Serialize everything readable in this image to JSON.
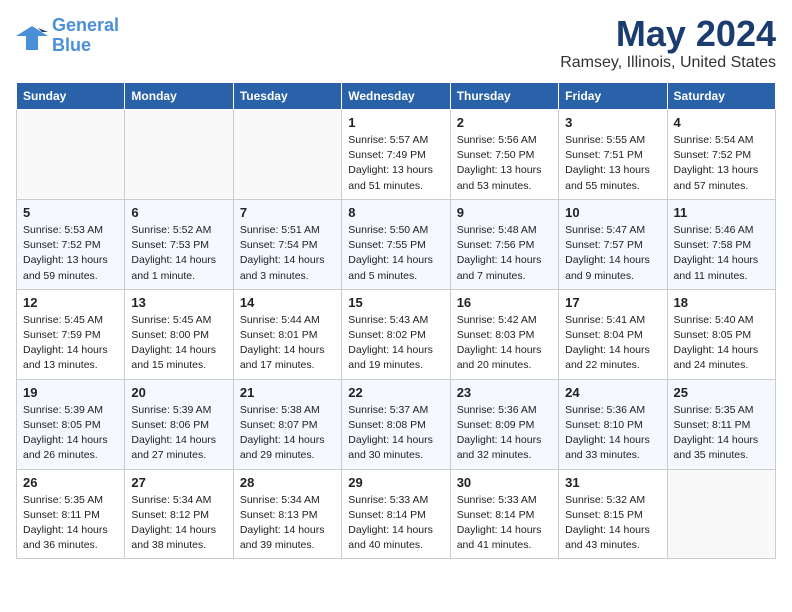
{
  "logo": {
    "line1": "General",
    "line2": "Blue"
  },
  "title": {
    "month": "May 2024",
    "location": "Ramsey, Illinois, United States"
  },
  "headers": [
    "Sunday",
    "Monday",
    "Tuesday",
    "Wednesday",
    "Thursday",
    "Friday",
    "Saturday"
  ],
  "weeks": [
    [
      {
        "day": "",
        "info": ""
      },
      {
        "day": "",
        "info": ""
      },
      {
        "day": "",
        "info": ""
      },
      {
        "day": "1",
        "info": "Sunrise: 5:57 AM\nSunset: 7:49 PM\nDaylight: 13 hours\nand 51 minutes."
      },
      {
        "day": "2",
        "info": "Sunrise: 5:56 AM\nSunset: 7:50 PM\nDaylight: 13 hours\nand 53 minutes."
      },
      {
        "day": "3",
        "info": "Sunrise: 5:55 AM\nSunset: 7:51 PM\nDaylight: 13 hours\nand 55 minutes."
      },
      {
        "day": "4",
        "info": "Sunrise: 5:54 AM\nSunset: 7:52 PM\nDaylight: 13 hours\nand 57 minutes."
      }
    ],
    [
      {
        "day": "5",
        "info": "Sunrise: 5:53 AM\nSunset: 7:52 PM\nDaylight: 13 hours\nand 59 minutes."
      },
      {
        "day": "6",
        "info": "Sunrise: 5:52 AM\nSunset: 7:53 PM\nDaylight: 14 hours\nand 1 minute."
      },
      {
        "day": "7",
        "info": "Sunrise: 5:51 AM\nSunset: 7:54 PM\nDaylight: 14 hours\nand 3 minutes."
      },
      {
        "day": "8",
        "info": "Sunrise: 5:50 AM\nSunset: 7:55 PM\nDaylight: 14 hours\nand 5 minutes."
      },
      {
        "day": "9",
        "info": "Sunrise: 5:48 AM\nSunset: 7:56 PM\nDaylight: 14 hours\nand 7 minutes."
      },
      {
        "day": "10",
        "info": "Sunrise: 5:47 AM\nSunset: 7:57 PM\nDaylight: 14 hours\nand 9 minutes."
      },
      {
        "day": "11",
        "info": "Sunrise: 5:46 AM\nSunset: 7:58 PM\nDaylight: 14 hours\nand 11 minutes."
      }
    ],
    [
      {
        "day": "12",
        "info": "Sunrise: 5:45 AM\nSunset: 7:59 PM\nDaylight: 14 hours\nand 13 minutes."
      },
      {
        "day": "13",
        "info": "Sunrise: 5:45 AM\nSunset: 8:00 PM\nDaylight: 14 hours\nand 15 minutes."
      },
      {
        "day": "14",
        "info": "Sunrise: 5:44 AM\nSunset: 8:01 PM\nDaylight: 14 hours\nand 17 minutes."
      },
      {
        "day": "15",
        "info": "Sunrise: 5:43 AM\nSunset: 8:02 PM\nDaylight: 14 hours\nand 19 minutes."
      },
      {
        "day": "16",
        "info": "Sunrise: 5:42 AM\nSunset: 8:03 PM\nDaylight: 14 hours\nand 20 minutes."
      },
      {
        "day": "17",
        "info": "Sunrise: 5:41 AM\nSunset: 8:04 PM\nDaylight: 14 hours\nand 22 minutes."
      },
      {
        "day": "18",
        "info": "Sunrise: 5:40 AM\nSunset: 8:05 PM\nDaylight: 14 hours\nand 24 minutes."
      }
    ],
    [
      {
        "day": "19",
        "info": "Sunrise: 5:39 AM\nSunset: 8:05 PM\nDaylight: 14 hours\nand 26 minutes."
      },
      {
        "day": "20",
        "info": "Sunrise: 5:39 AM\nSunset: 8:06 PM\nDaylight: 14 hours\nand 27 minutes."
      },
      {
        "day": "21",
        "info": "Sunrise: 5:38 AM\nSunset: 8:07 PM\nDaylight: 14 hours\nand 29 minutes."
      },
      {
        "day": "22",
        "info": "Sunrise: 5:37 AM\nSunset: 8:08 PM\nDaylight: 14 hours\nand 30 minutes."
      },
      {
        "day": "23",
        "info": "Sunrise: 5:36 AM\nSunset: 8:09 PM\nDaylight: 14 hours\nand 32 minutes."
      },
      {
        "day": "24",
        "info": "Sunrise: 5:36 AM\nSunset: 8:10 PM\nDaylight: 14 hours\nand 33 minutes."
      },
      {
        "day": "25",
        "info": "Sunrise: 5:35 AM\nSunset: 8:11 PM\nDaylight: 14 hours\nand 35 minutes."
      }
    ],
    [
      {
        "day": "26",
        "info": "Sunrise: 5:35 AM\nSunset: 8:11 PM\nDaylight: 14 hours\nand 36 minutes."
      },
      {
        "day": "27",
        "info": "Sunrise: 5:34 AM\nSunset: 8:12 PM\nDaylight: 14 hours\nand 38 minutes."
      },
      {
        "day": "28",
        "info": "Sunrise: 5:34 AM\nSunset: 8:13 PM\nDaylight: 14 hours\nand 39 minutes."
      },
      {
        "day": "29",
        "info": "Sunrise: 5:33 AM\nSunset: 8:14 PM\nDaylight: 14 hours\nand 40 minutes."
      },
      {
        "day": "30",
        "info": "Sunrise: 5:33 AM\nSunset: 8:14 PM\nDaylight: 14 hours\nand 41 minutes."
      },
      {
        "day": "31",
        "info": "Sunrise: 5:32 AM\nSunset: 8:15 PM\nDaylight: 14 hours\nand 43 minutes."
      },
      {
        "day": "",
        "info": ""
      }
    ]
  ]
}
